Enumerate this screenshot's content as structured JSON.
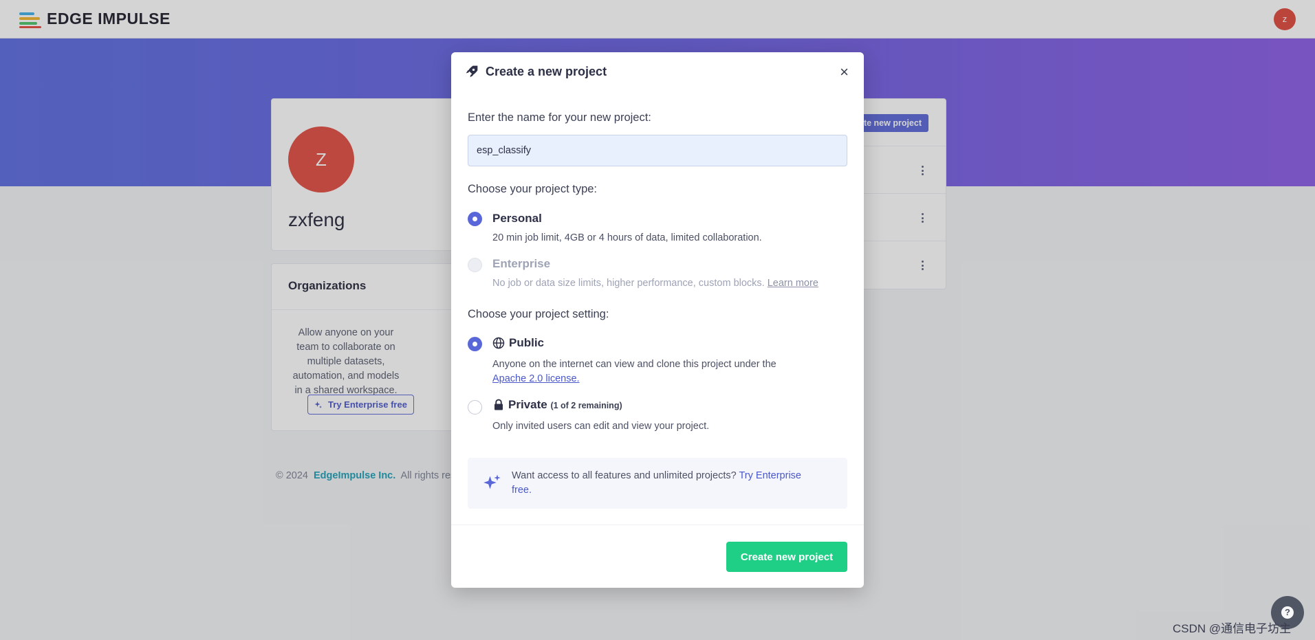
{
  "app": {
    "logo_text": "EDGE IMPULSE",
    "user_initial": "z"
  },
  "profile": {
    "avatar_initial": "Z",
    "username": "zxfeng"
  },
  "organizations": {
    "title": "Organizations",
    "description": "Allow anyone on your team to collaborate on multiple datasets, automation, and models in a shared workspace.",
    "button_label": "Try Enterprise free"
  },
  "footer": {
    "copyright": "© 2024",
    "company": "EdgeImpulse Inc.",
    "rights": "All rights rese"
  },
  "projects": {
    "create_button_label": "te new project"
  },
  "modal": {
    "title": "Create a new project",
    "close_label": "×",
    "name_label": "Enter the name for your new project:",
    "name_value": "esp_classify",
    "type_label": "Choose your project type:",
    "personal": {
      "title": "Personal",
      "desc": "20 min job limit, 4GB or 4 hours of data, limited collaboration.",
      "selected": true
    },
    "enterprise": {
      "title": "Enterprise",
      "desc": "No job or data size limits, higher performance, custom blocks.",
      "link": "Learn more",
      "disabled": true
    },
    "setting_label": "Choose your project setting:",
    "public": {
      "title": "Public",
      "desc": "Anyone on the internet can view and clone this project under the",
      "link": "Apache 2.0 license.",
      "selected": true
    },
    "private": {
      "title": "Private",
      "note": "(1 of 2 remaining)",
      "desc": "Only invited users can edit and view your project.",
      "selected": false
    },
    "info": {
      "text": "Want access to all features and unlimited projects?",
      "link": "Try Enterprise free."
    },
    "submit_label": "Create new project"
  },
  "watermark": "CSDN @通信电子坊主",
  "colors": {
    "accent": "#5a67d8",
    "success": "#1fcf86",
    "avatar": "#e24c40"
  }
}
